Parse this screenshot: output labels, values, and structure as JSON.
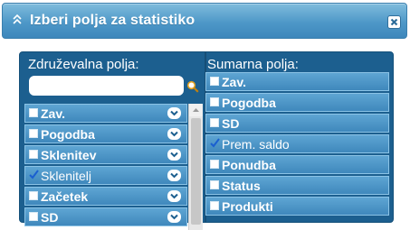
{
  "dialog": {
    "title": "Izberi polja za statistiko",
    "title_icon": "double-chevron-up-icon",
    "close_icon": "close-icon"
  },
  "left_column": {
    "title": "Združevalna polja:",
    "search": {
      "value": "",
      "placeholder": ""
    },
    "items": [
      {
        "label": "Zav.",
        "checked": false
      },
      {
        "label": "Pogodba",
        "checked": false
      },
      {
        "label": "Sklenitev",
        "checked": false
      },
      {
        "label": "Sklenitelj",
        "checked": true
      },
      {
        "label": "Začetek",
        "checked": false
      },
      {
        "label": "SD",
        "checked": false
      }
    ]
  },
  "right_column": {
    "title": "Sumarna polja:",
    "items": [
      {
        "label": "Zav.",
        "checked": false
      },
      {
        "label": "Pogodba",
        "checked": false
      },
      {
        "label": "SD",
        "checked": false
      },
      {
        "label": "Prem. saldo",
        "checked": true
      },
      {
        "label": "Ponudba",
        "checked": false
      },
      {
        "label": "Status",
        "checked": false
      },
      {
        "label": "Produkti",
        "checked": false
      }
    ]
  },
  "colors": {
    "titlebar": "#4e98c8",
    "panel": "#1c5f8f",
    "item": "#3f88bc",
    "check": "#1a5fd0"
  }
}
